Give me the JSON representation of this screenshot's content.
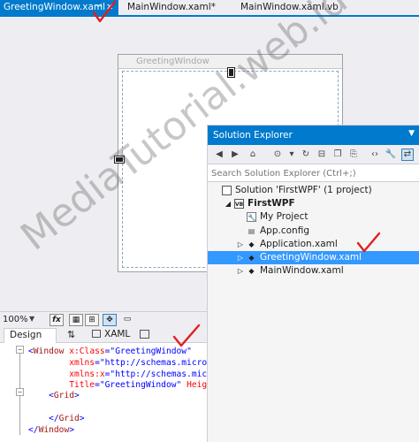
{
  "tabs": [
    {
      "label": "GreetingWindow.xaml",
      "active": true
    },
    {
      "label": "MainWindow.xaml*",
      "active": false
    },
    {
      "label": "MainWindow.xaml.vb",
      "active": false
    }
  ],
  "designer": {
    "window_title": "GreetingWindow",
    "zoom": "100%",
    "fx_label": "fx",
    "design_tab": "Design",
    "xaml_tab": "XAML"
  },
  "xaml": {
    "lines": [
      {
        "parts": [
          {
            "t": "<",
            "c": "p"
          },
          {
            "t": "Window",
            "c": "k"
          },
          {
            "t": " x:Class",
            "c": "a"
          },
          {
            "t": "=\"GreetingWindow\"",
            "c": "s"
          }
        ]
      },
      {
        "parts": [
          {
            "t": "        xmlns",
            "c": "a"
          },
          {
            "t": "=\"http://schemas.microsoft",
            "c": "s"
          }
        ]
      },
      {
        "parts": [
          {
            "t": "        xmlns:x",
            "c": "a"
          },
          {
            "t": "=\"http://schemas.microsoft",
            "c": "s"
          }
        ]
      },
      {
        "parts": [
          {
            "t": "        Title",
            "c": "a"
          },
          {
            "t": "=\"GreetingWindow\"",
            "c": "s"
          },
          {
            "t": " Height",
            "c": "a"
          },
          {
            "t": "=\"",
            "c": "s"
          }
        ]
      },
      {
        "parts": [
          {
            "t": "    <",
            "c": "p"
          },
          {
            "t": "Grid",
            "c": "k"
          },
          {
            "t": ">",
            "c": "p"
          }
        ]
      },
      {
        "parts": [
          {
            "t": "",
            "c": "p"
          }
        ]
      },
      {
        "parts": [
          {
            "t": "    </",
            "c": "p"
          },
          {
            "t": "Grid",
            "c": "k"
          },
          {
            "t": ">",
            "c": "p"
          }
        ]
      },
      {
        "parts": [
          {
            "t": "</",
            "c": "p"
          },
          {
            "t": "Window",
            "c": "k"
          },
          {
            "t": ">",
            "c": "p"
          }
        ]
      }
    ]
  },
  "solution_explorer": {
    "title": "Solution Explorer",
    "search_placeholder": "Search Solution Explorer (Ctrl+;)",
    "items": [
      {
        "label": "Solution 'FirstWPF' (1 project)",
        "icon": "solution-icon",
        "glyph": "",
        "indent": 0,
        "expander": "",
        "bold": false,
        "selected": false
      },
      {
        "label": "FirstWPF",
        "icon": "vb-project-icon",
        "glyph": "VB",
        "indent": 1,
        "expander": "◢",
        "bold": true,
        "selected": false
      },
      {
        "label": "My Project",
        "icon": "wrench-icon",
        "glyph": "🔧",
        "indent": 2,
        "expander": "",
        "bold": false,
        "selected": false
      },
      {
        "label": "App.config",
        "icon": "config-file-icon",
        "glyph": "▤",
        "indent": 2,
        "expander": "",
        "bold": false,
        "selected": false
      },
      {
        "label": "Application.xaml",
        "icon": "xaml-file-icon",
        "glyph": "◆",
        "indent": 2,
        "expander": "▷",
        "bold": false,
        "selected": false
      },
      {
        "label": "GreetingWindow.xaml",
        "icon": "xaml-file-icon",
        "glyph": "◆",
        "indent": 2,
        "expander": "▷",
        "bold": false,
        "selected": true
      },
      {
        "label": "MainWindow.xaml",
        "icon": "xaml-file-icon",
        "glyph": "◆",
        "indent": 2,
        "expander": "▷",
        "bold": false,
        "selected": false
      }
    ]
  },
  "watermark": "MediaTutorial.web.id",
  "colors": {
    "accent": "#007acc",
    "selection": "#3399ff",
    "check": "#e02020"
  }
}
